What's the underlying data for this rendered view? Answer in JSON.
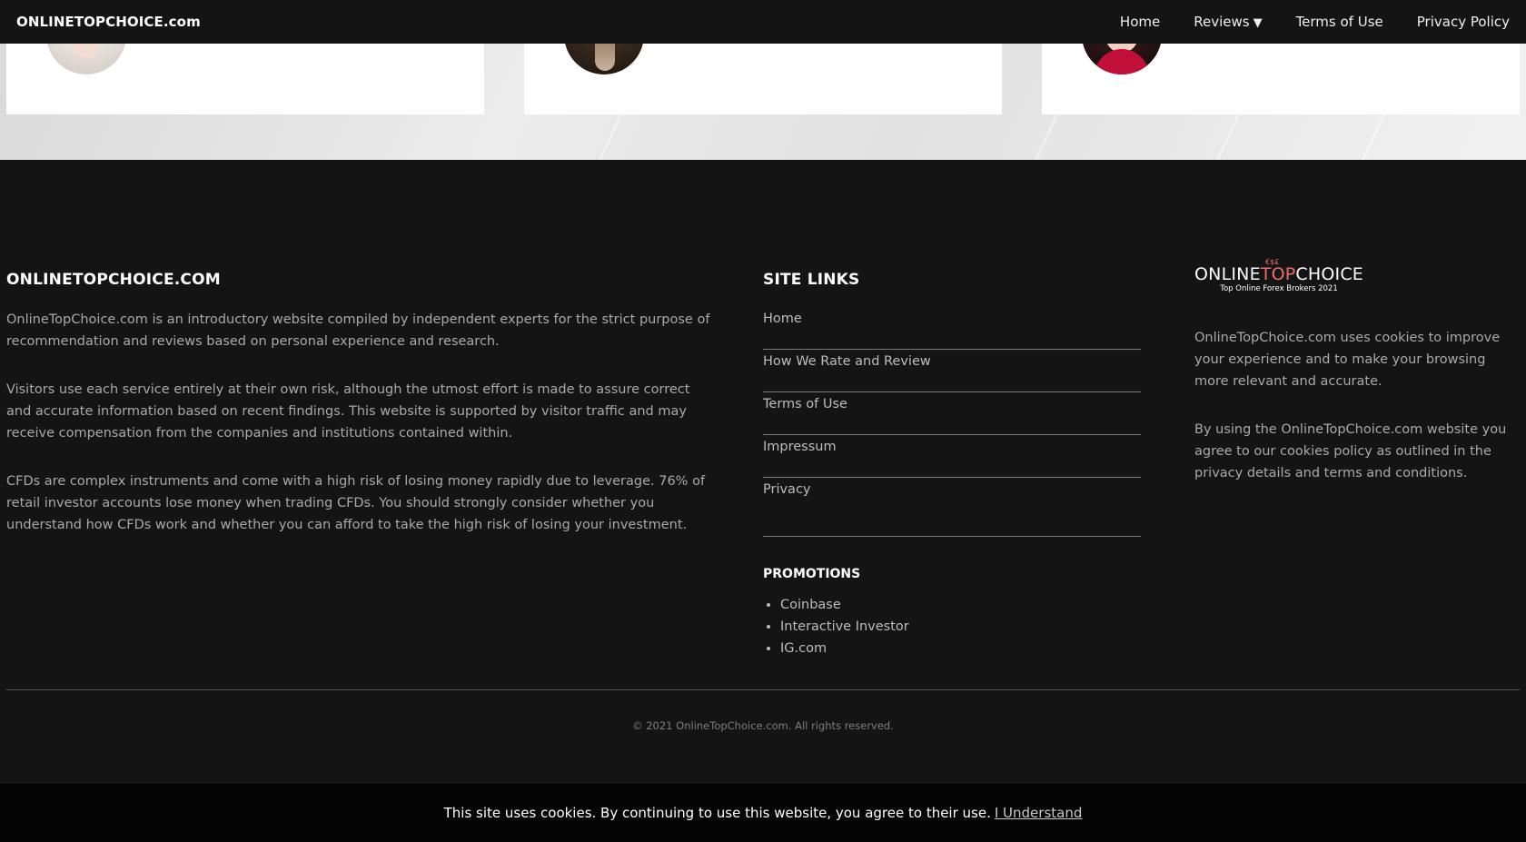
{
  "nav": {
    "brand": "ONLINETOPCHOICE.com",
    "links": [
      "Home",
      "Reviews",
      "Terms of Use",
      "Privacy Policy"
    ],
    "reviews_caret": "▼"
  },
  "about": {
    "heading": "ONLINETOPCHOICE.COM",
    "paragraphs": [
      "OnlineTopChoice.com is an introductory website compiled by independent experts for the strict purpose of recommendation and reviews based on personal experience and research.",
      "Visitors use each service entirely at their own risk, although the utmost effort is made to assure correct and accurate information based on recent findings. This website is supported by visitor traffic and may receive compensation from the companies and institutions contained within.",
      "CFDs are complex instruments and come with a high risk of losing money rapidly due to leverage. 76% of retail investor accounts lose money when trading CFDs. You should strongly consider whether you understand how CFDs work and whether you can afford to take the high risk of losing your investment."
    ]
  },
  "site_links": {
    "heading": "SITE LINKS",
    "items": [
      "Home",
      "How We Rate and Review",
      "Terms of Use",
      "Impressum",
      "Privacy"
    ]
  },
  "promotions": {
    "heading": "PROMOTIONS",
    "items": [
      "Coinbase",
      "Interactive Investor",
      "IG.com"
    ]
  },
  "logo": {
    "part1": "ONLINE",
    "part2": "TOP",
    "part3": "CHOICE",
    "tagline": "Top Online Forex Brokers 2021",
    "mark": "€$£",
    "accent_color": "#ef6b6b"
  },
  "cookie_info": {
    "paragraphs": [
      "OnlineTopChoice.com uses cookies to improve your experience and to make your browsing more relevant and accurate.",
      "By using the OnlineTopChoice.com website you agree to our cookies policy as outlined in the privacy details and terms and conditions."
    ]
  },
  "copyright": "© 2021 OnlineTopChoice.com. All rights reserved.",
  "cookie_bar": {
    "text": "This site uses cookies. By continuing to use this website, you agree to their use.",
    "link": "I Understand"
  }
}
